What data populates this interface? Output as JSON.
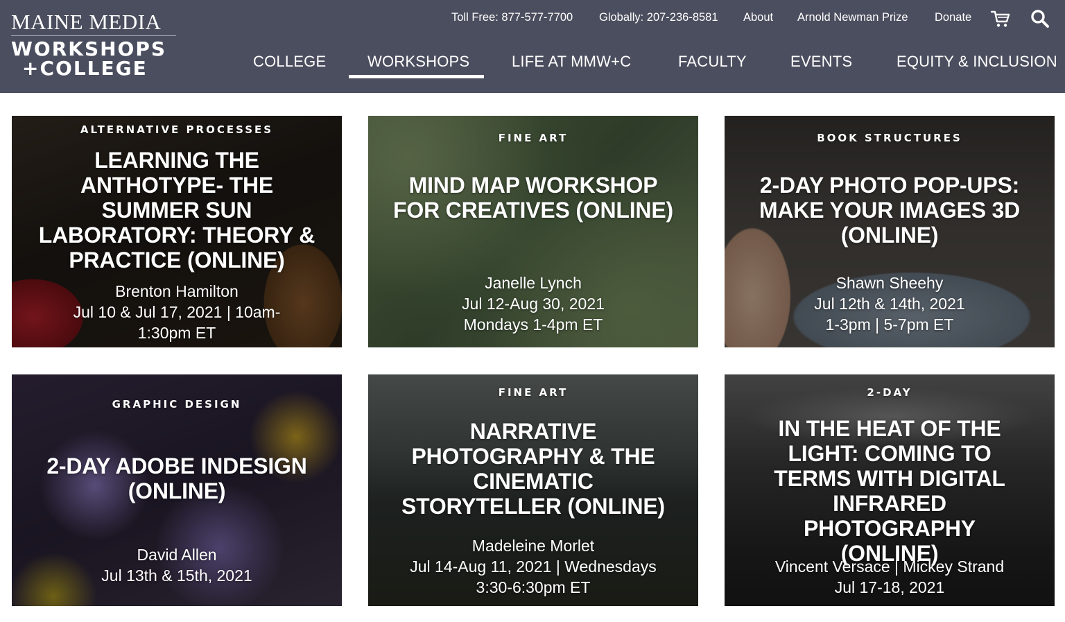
{
  "header": {
    "logo": {
      "line1": "MAINE MEDIA",
      "line2": "WORKSHOPS",
      "line3": "+COLLEGE"
    },
    "utility": {
      "toll_free": "Toll Free: 877-577-7700",
      "globally": "Globally: 207-236-8581",
      "about": "About",
      "newman_prize": "Arnold Newman Prize",
      "donate": "Donate"
    },
    "icons": {
      "cart": "cart-icon",
      "search": "search-icon"
    },
    "nav": {
      "items": [
        "COLLEGE",
        "WORKSHOPS",
        "LIFE AT MMW+C",
        "FACULTY",
        "EVENTS",
        "EQUITY & INCLUSION"
      ],
      "active": "WORKSHOPS"
    }
  },
  "cards": [
    {
      "category": "ALTERNATIVE PROCESSES",
      "title": "LEARNING THE ANTHOTYPE- THE SUMMER SUN LABORATORY: THEORY & PRACTICE (ONLINE)",
      "instructor": "Brenton Hamilton",
      "dates": "Jul 10 & Jul 17, 2021 | 10am-1:30pm ET"
    },
    {
      "category": "FINE ART",
      "title": "MIND MAP WORKSHOP FOR CREATIVES (ONLINE)",
      "instructor": "Janelle Lynch",
      "dates": "Jul 12-Aug 30, 2021",
      "times": "Mondays 1-4pm ET"
    },
    {
      "category": "BOOK STRUCTURES",
      "title": "2-DAY PHOTO POP-UPS: MAKE YOUR IMAGES 3D (ONLINE)",
      "instructor": "Shawn Sheehy",
      "dates": "Jul 12th & 14th, 2021",
      "times": "1-3pm | 5-7pm ET"
    },
    {
      "category": "GRAPHIC DESIGN",
      "title": "2-DAY ADOBE INDESIGN (ONLINE)",
      "instructor": "David Allen",
      "dates": "Jul 13th & 15th, 2021"
    },
    {
      "category": "FINE ART",
      "title": "NARRATIVE PHOTOGRAPHY & THE CINEMATIC STORYTELLER (ONLINE)",
      "instructor": "Madeleine Morlet",
      "dates": "Jul 14-Aug 11, 2021 | Wednesdays 3:30-6:30pm ET"
    },
    {
      "category": "2-DAY",
      "title": "IN THE HEAT OF THE LIGHT: COMING TO TERMS WITH DIGITAL INFRARED PHOTOGRAPHY (ONLINE)",
      "instructor": "Vincent Versace  |  Mickey Strand",
      "dates": "Jul 17-18, 2021"
    }
  ],
  "colors": {
    "header_bg": "#4b4e5e",
    "text": "#ffffff"
  }
}
